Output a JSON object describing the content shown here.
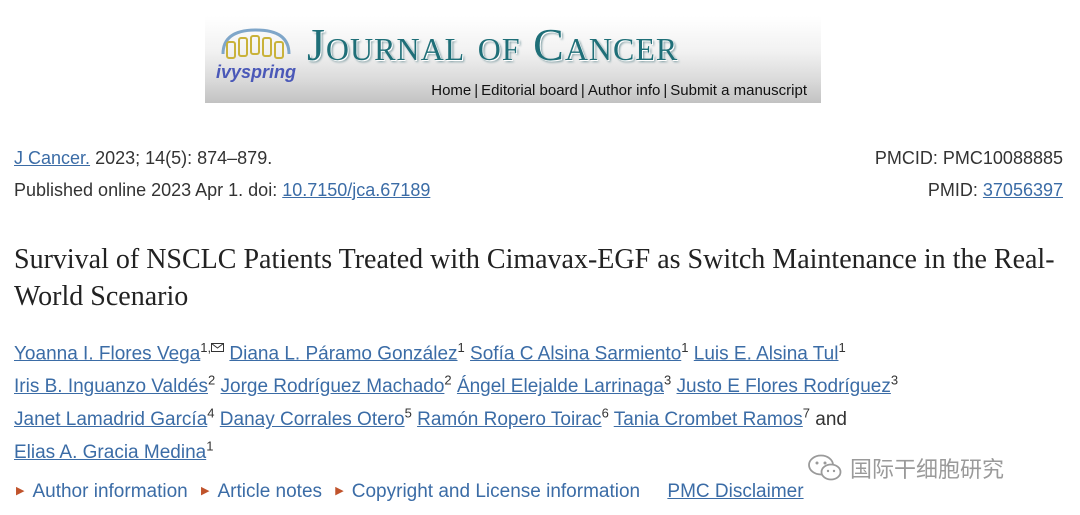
{
  "masthead": {
    "logo_text": "ivyspring",
    "journal_name": "Journal of Cancer",
    "nav": [
      "Home",
      "Editorial board",
      "Author info",
      "Submit a manuscript"
    ]
  },
  "citation": {
    "journal_link": "J Cancer.",
    "volume_info": "2023; 14(5): 874–879.",
    "published_prefix": "Published online 2023 Apr 1. doi:",
    "doi": "10.7150/jca.67189",
    "pmcid_label": "PMCID: PMC10088885",
    "pmid_label": "PMID:",
    "pmid_value": "37056397"
  },
  "article": {
    "title": "Survival of NSCLC Patients Treated with Cimavax-EGF as Switch Maintenance in the Real-World Scenario"
  },
  "authors": [
    {
      "name": "Yoanna I. Flores Vega",
      "sup": "1,"
    },
    {
      "name": "Diana L. Páramo González",
      "sup": "1"
    },
    {
      "name": "Sofía C Alsina Sarmiento",
      "sup": "1"
    },
    {
      "name": "Luis E. Alsina Tul",
      "sup": "1"
    },
    {
      "name": "Iris B. Inguanzo Valdés",
      "sup": "2"
    },
    {
      "name": "Jorge Rodríguez Machado",
      "sup": "2"
    },
    {
      "name": "Ángel Elejalde Larrinaga",
      "sup": "3"
    },
    {
      "name": "Justo E Flores Rodríguez",
      "sup": "3"
    },
    {
      "name": "Janet Lamadrid García",
      "sup": "4"
    },
    {
      "name": "Danay Corrales Otero",
      "sup": "5"
    },
    {
      "name": "Ramón Ropero Toirac",
      "sup": "6"
    },
    {
      "name": "Tania Crombet Ramos",
      "sup": "7"
    },
    {
      "name": "Elias A. Gracia Medina",
      "sup": "1"
    }
  ],
  "authors_and": "and",
  "bottom_links": {
    "author_information": "Author information",
    "article_notes": "Article notes",
    "copyright": "Copyright and License information",
    "disclaimer": "PMC Disclaimer"
  },
  "watermark": "国际干细胞研究",
  "colors": {
    "link": "#3b6ca6",
    "title_teal": "#1f6f78",
    "triangle": "#c0532b"
  }
}
